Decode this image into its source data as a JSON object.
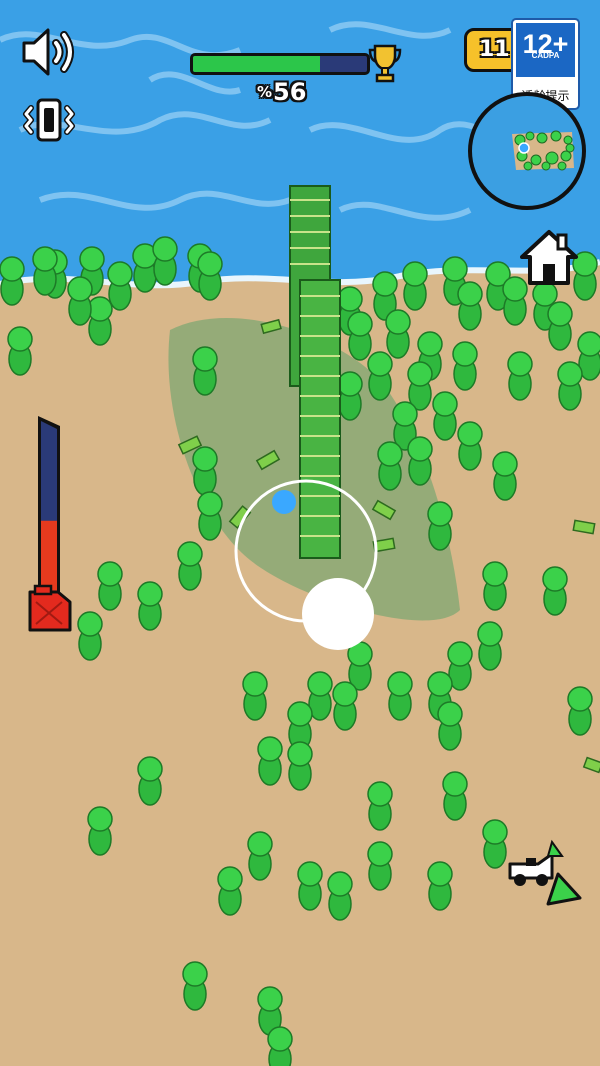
{
  "hud": {
    "sound_icon": "speaker-icon",
    "vibration_icon": "vibration-icon",
    "level_progress": {
      "percent_symbol": "%",
      "value": "56",
      "fill_fraction": 0.73,
      "trophy_icon": "trophy-icon"
    },
    "coins": {
      "value": "11",
      "coin_icon": "money-stack-icon"
    },
    "age_rating": {
      "label": "12+",
      "org": "CADPA",
      "hint": "适龄提示"
    },
    "minimap_icon": "minimap",
    "home_icon": "home-icon",
    "fuel": {
      "level_fraction": 0.42,
      "icon": "fuel-can-icon"
    },
    "offscreen_vehicle_icon": "truck-icon"
  },
  "colors": {
    "water": "#3b9fe2",
    "sand": "#d7b588",
    "crowd": "#3bd14a",
    "progress_fill": "#2cc64a",
    "progress_track": "#2a3a78",
    "fuel_fill": "#e63a1e",
    "fuel_track": "#2a3a78",
    "coin_badge": "#f6c12a",
    "age_badge": "#1b67c4"
  }
}
